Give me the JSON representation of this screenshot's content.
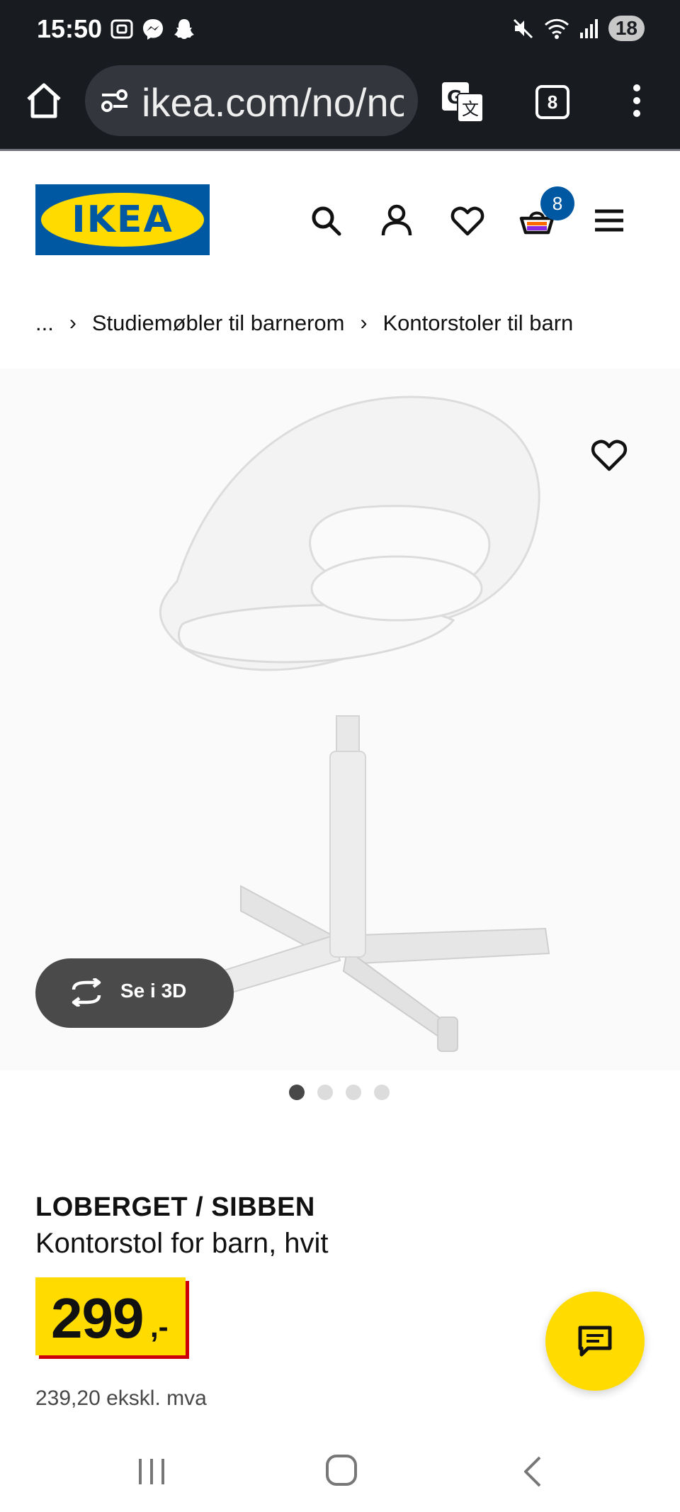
{
  "status_bar": {
    "time": "15:50",
    "battery": "18",
    "icons_left": [
      "screenshot-icon",
      "messenger-icon",
      "snapchat-icon"
    ],
    "icons_right": [
      "mute-icon",
      "wifi-icon",
      "signal-icon"
    ]
  },
  "browser": {
    "url": "ikea.com/no/no/p/loberget-sibben",
    "tab_count": "8"
  },
  "header": {
    "logo_text": "IKEA",
    "cart_count": "8",
    "brand_blue": "#0058a3",
    "brand_yellow": "#ffdb00"
  },
  "breadcrumb": {
    "ellipsis": "...",
    "items": [
      "Studiemøbler til barnerom",
      "Kontorstoler til barn"
    ]
  },
  "gallery": {
    "view_3d_label": "Se i 3D",
    "image_count": 4,
    "active_index": 0
  },
  "product": {
    "name": "LOBERGET / SIBBEN",
    "description": "Kontorstol for barn, hvit",
    "price_integer": "299",
    "price_suffix": ",-",
    "price_ex_vat": "239,20 ekskl. mva"
  }
}
